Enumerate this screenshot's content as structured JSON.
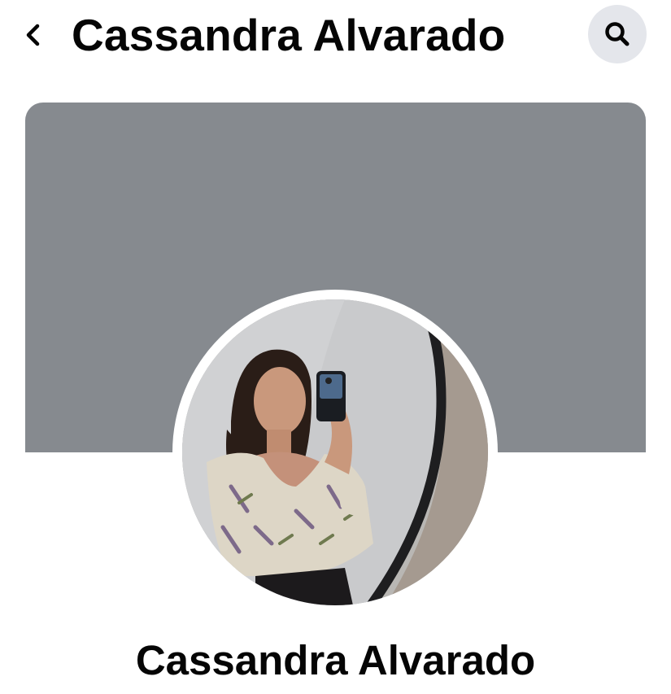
{
  "header": {
    "title": "Cassandra Alvarado",
    "back_icon": "chevron-left-icon",
    "search_icon": "search-icon"
  },
  "cover": {
    "color": "#868a8f"
  },
  "profile": {
    "name": "Cassandra Alvarado",
    "photo": "profile-photo"
  },
  "colors": {
    "text": "#050505",
    "search_button_bg": "#e4e6eb",
    "background": "#ffffff"
  }
}
